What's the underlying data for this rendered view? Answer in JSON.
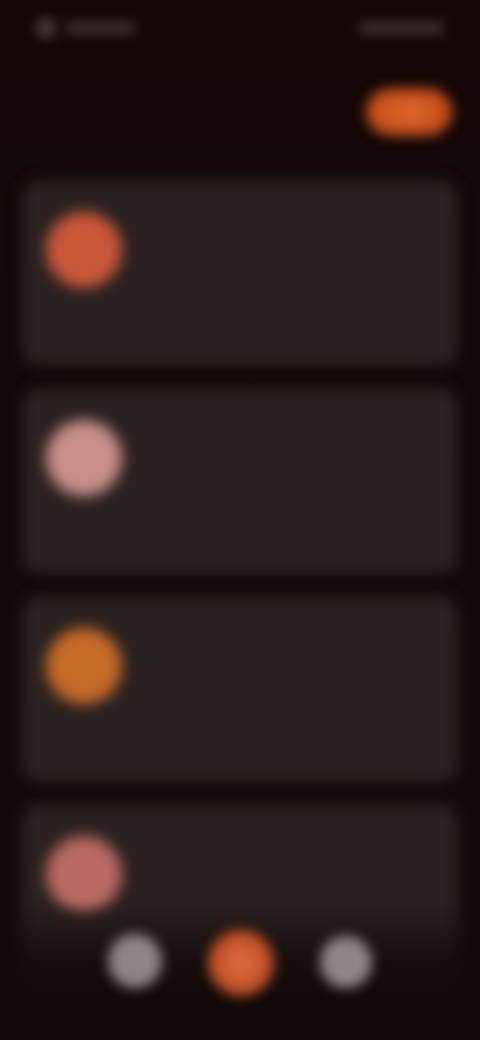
{
  "colors": {
    "background": "#120606",
    "card": "#2a2120",
    "accent": "#d8602a",
    "badge": "#8c7a3c"
  },
  "status_bar": {
    "icon": "signal-icon"
  },
  "header": {
    "title": "",
    "subtitle": "",
    "action_label": ""
  },
  "cards": [
    {
      "avatar_color": "#c9573a",
      "title": "",
      "description": "",
      "badge": "",
      "footer_left": "",
      "footer_right": ""
    },
    {
      "avatar_color": "#c98f8a",
      "title": "",
      "description": "",
      "badge": "",
      "footer_left": "",
      "footer_right": ""
    },
    {
      "avatar_color": "#c66a27",
      "title": "",
      "description": "",
      "badge": "",
      "footer_left": "",
      "footer_right": ""
    },
    {
      "avatar_color": "#b96a62",
      "title": "",
      "description": "",
      "badge": "",
      "footer_left": "",
      "footer_right": ""
    }
  ],
  "bottom_nav": {
    "items": [
      {
        "icon": "home-icon"
      },
      {
        "icon": "add-icon"
      },
      {
        "icon": "profile-icon"
      }
    ]
  }
}
